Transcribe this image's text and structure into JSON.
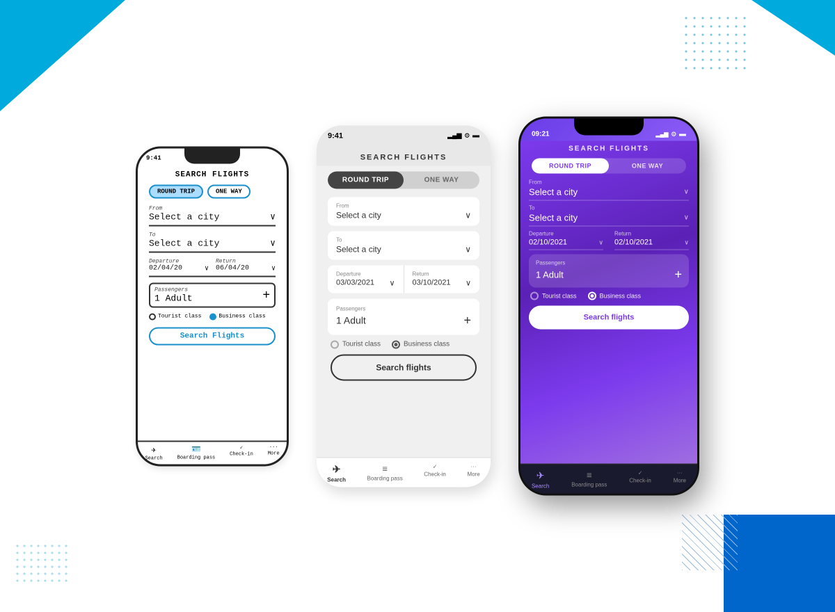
{
  "background": {
    "accent_color": "#00aadd",
    "secondary_color": "#0066cc"
  },
  "phone1_sketch": {
    "status_time": "9:41",
    "title": "SEARCH FLIGHTS",
    "toggle": {
      "round_trip": "ROUND TRIP",
      "one_way": "ONE WAY"
    },
    "from_label": "From",
    "from_placeholder": "Select a city",
    "to_label": "To",
    "to_placeholder": "Select a city",
    "departure_label": "Departure",
    "departure_value": "02/04/20",
    "return_label": "Return",
    "return_value": "06/04/20",
    "passengers_label": "Passengers",
    "passengers_value": "1 Adult",
    "class_tourist": "Tourist class",
    "class_business": "Business class",
    "search_btn": "Search Flights",
    "nav": {
      "search": "Search",
      "boarding": "Boarding pass",
      "checkin": "Check-in",
      "more": "More"
    }
  },
  "phone2_wire": {
    "status_time": "9:41",
    "title": "SEARCH FLIGHTS",
    "toggle": {
      "round_trip": "ROUND TRIP",
      "one_way": "ONE WAY"
    },
    "from_label": "From",
    "from_placeholder": "Select a city",
    "to_label": "To",
    "to_placeholder": "Select a city",
    "departure_label": "Departure",
    "departure_value": "03/03/2021",
    "return_label": "Return",
    "return_value": "03/10/2021",
    "passengers_label": "Passengers",
    "passengers_value": "1 Adult",
    "class_tourist": "Tourist class",
    "class_business": "Business class",
    "search_btn": "Search flights",
    "nav": {
      "search": "Search",
      "boarding": "Boarding pass",
      "checkin": "Check-in",
      "more": "More"
    }
  },
  "phone3_final": {
    "status_time": "09:21",
    "title": "SEARCH FLIGHTS",
    "toggle": {
      "round_trip": "ROUND TRIP",
      "one_way": "ONE WAY"
    },
    "from_label": "From",
    "from_placeholder": "Select a city",
    "to_label": "To",
    "to_placeholder": "Select a city",
    "departure_label": "Departure",
    "departure_value": "02/10/2021",
    "return_label": "Return",
    "return_value": "02/10/2021",
    "passengers_label": "Passengers",
    "passengers_value": "1 Adult",
    "class_tourist": "Tourist class",
    "class_business": "Business class",
    "search_btn": "Search flights",
    "nav": {
      "search": "Search",
      "boarding": "Boarding pass",
      "checkin": "Check-in",
      "more": "More"
    }
  }
}
